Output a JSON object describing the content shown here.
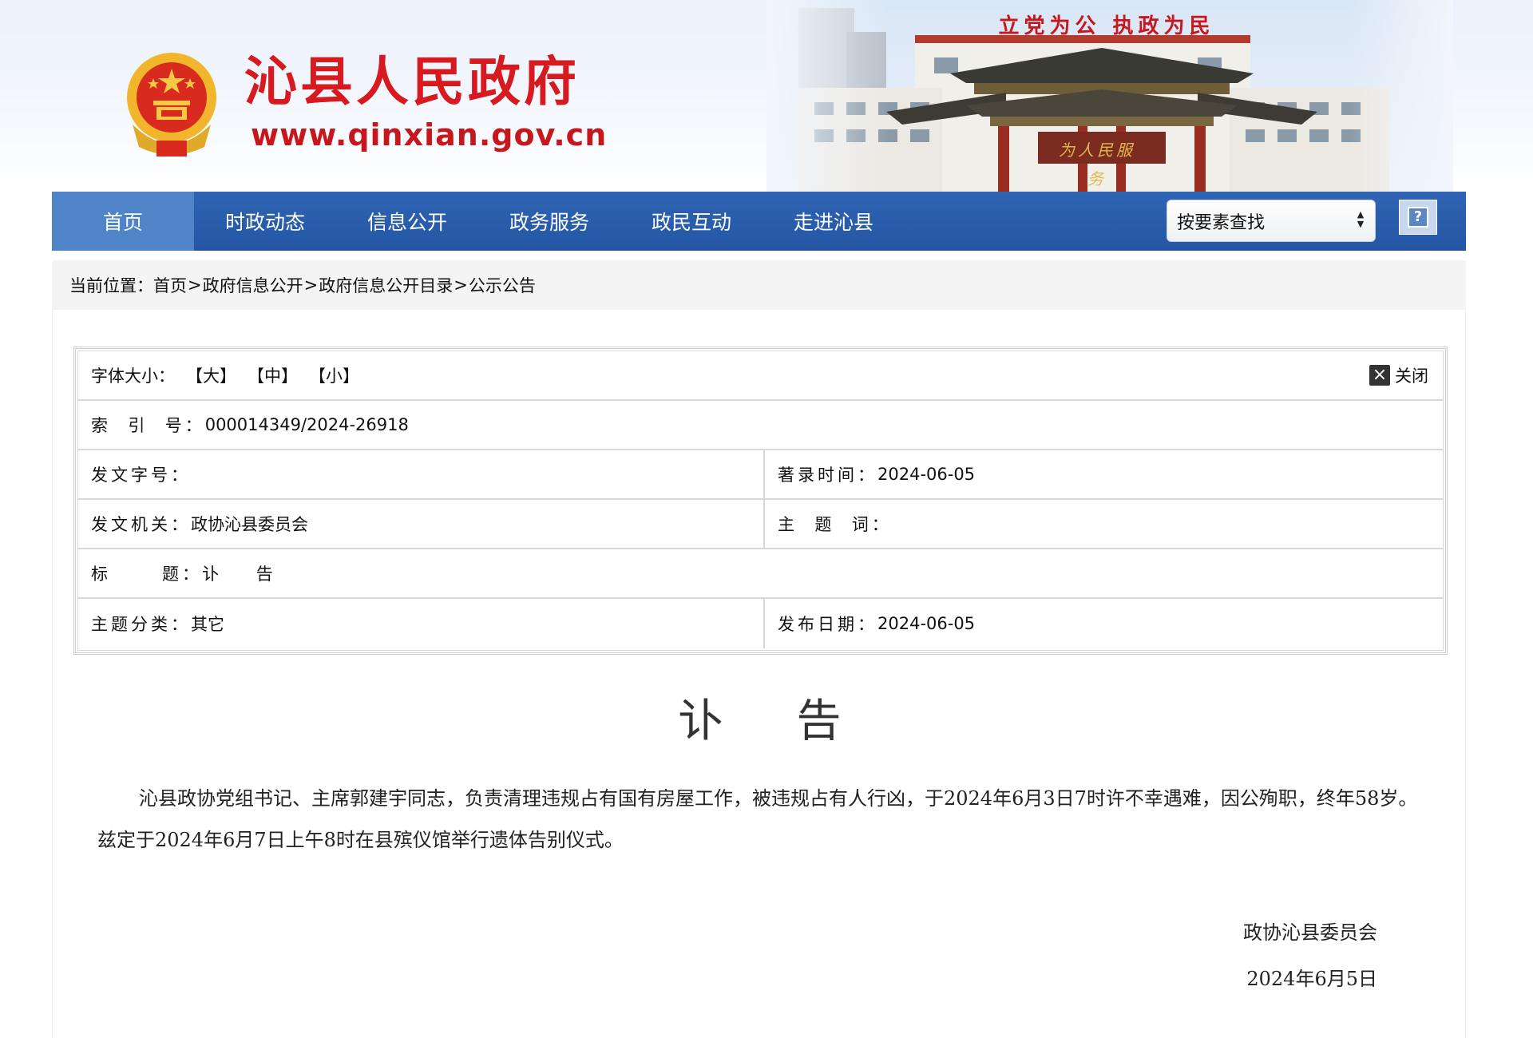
{
  "site": {
    "title": "沁县人民政府",
    "url": "www.qinxian.gov.cn",
    "slogan": "立党为公 执政为民",
    "gate_plaque": "为人民服务"
  },
  "nav": {
    "items": [
      {
        "label": "首页",
        "active": true
      },
      {
        "label": "时政动态"
      },
      {
        "label": "信息公开"
      },
      {
        "label": "政务服务"
      },
      {
        "label": "政民互动"
      },
      {
        "label": "走进沁县"
      }
    ],
    "search_select": "按要素查找",
    "search_button_icon": "?"
  },
  "breadcrumb": {
    "prefix": "当前位置：",
    "items": [
      "首页",
      "政府信息公开",
      "政府信息公开目录",
      "公示公告"
    ],
    "separator": ">"
  },
  "info": {
    "font_size_label": "字体大小：",
    "font_sizes": [
      "【大】",
      "【中】",
      "【小】"
    ],
    "close_label": "关闭",
    "index_label": "索  引  号：",
    "index_value": "000014349/2024-26918",
    "doc_no_label": "发文字号：",
    "doc_no_value": "",
    "record_time_label": "著录时间：",
    "record_time_value": "2024-06-05",
    "issuer_label": "发文机关：",
    "issuer_value": "政协沁县委员会",
    "keywords_label": "主  题  词：",
    "keywords_value": "",
    "title_label": "标      题：",
    "title_value": "讣    告",
    "category_label": "主题分类：",
    "category_value": "其它",
    "publish_date_label": "发布日期：",
    "publish_date_value": "2024-06-05"
  },
  "article": {
    "title": "讣告",
    "body": "沁县政协党组书记、主席郭建宇同志，负责清理违规占有国有房屋工作，被违规占有人行凶，于2024年6月3日7时许不幸遇难，因公殉职，终年58岁。兹定于2024年6月7日上午8时在县殡仪馆举行遗体告别仪式。",
    "signature": "政协沁县委员会",
    "date": "2024年6月5日"
  },
  "colors": {
    "nav_bg": "#2a5daf",
    "nav_active": "#4f84c9",
    "brand_red": "#d71920"
  }
}
